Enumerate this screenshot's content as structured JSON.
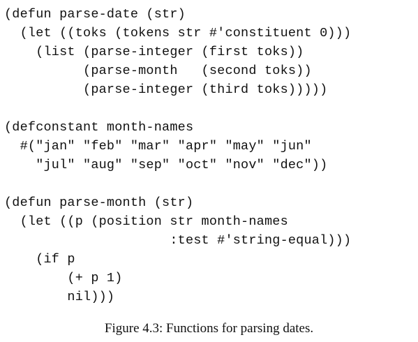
{
  "code_lines": [
    "(defun parse-date (str)",
    "  (let ((toks (tokens str #'constituent 0)))",
    "    (list (parse-integer (first toks))",
    "          (parse-month   (second toks))",
    "          (parse-integer (third toks)))))",
    "",
    "(defconstant month-names",
    "  #(\"jan\" \"feb\" \"mar\" \"apr\" \"may\" \"jun\"",
    "    \"jul\" \"aug\" \"sep\" \"oct\" \"nov\" \"dec\"))",
    "",
    "(defun parse-month (str)",
    "  (let ((p (position str month-names",
    "                     :test #'string-equal)))",
    "    (if p",
    "        (+ p 1)",
    "        nil)))"
  ],
  "caption": "Figure 4.3: Functions for parsing dates."
}
